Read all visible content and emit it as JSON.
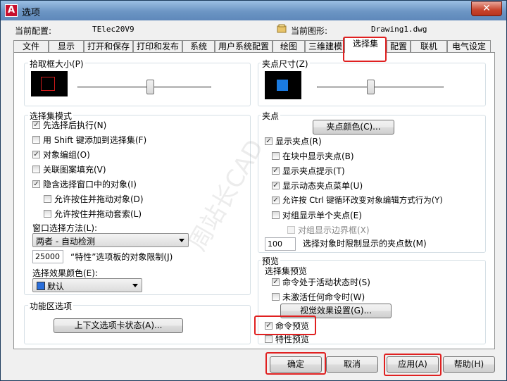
{
  "window": {
    "title": "选项",
    "close_glyph": "✕"
  },
  "header": {
    "profile_label": "当前配置:",
    "profile_value": "TElec20V9",
    "drawing_label": "当前图形:",
    "drawing_value": "Drawing1.dwg"
  },
  "tabs": [
    {
      "label": "文件"
    },
    {
      "label": "显示"
    },
    {
      "label": "打开和保存"
    },
    {
      "label": "打印和发布"
    },
    {
      "label": "系统"
    },
    {
      "label": "用户系统配置"
    },
    {
      "label": "绘图"
    },
    {
      "label": "三维建模"
    },
    {
      "label": "选择集"
    },
    {
      "label": "配置"
    },
    {
      "label": "联机"
    },
    {
      "label": "电气设定"
    }
  ],
  "pickbox": {
    "title": "拾取框大小(P)",
    "slider_level": 0.55,
    "preview_color": "#cc1a1a"
  },
  "grip_size": {
    "title": "夹点尺寸(Z)",
    "slider_level": 0.42,
    "preview_color": "#1a7ae0"
  },
  "selection_modes": {
    "title": "选择集模式",
    "items": [
      {
        "label": "先选择后执行(N)",
        "checked": true
      },
      {
        "label": "用 Shift 键添加到选择集(F)",
        "checked": false
      },
      {
        "label": "对象编组(O)",
        "checked": true
      },
      {
        "label": "关联图案填充(V)",
        "checked": false
      },
      {
        "label": "隐含选择窗口中的对象(I)",
        "checked": true
      },
      {
        "label": "允许按住并拖动对象(D)",
        "checked": false
      },
      {
        "label": "允许按住并拖动套索(L)",
        "checked": false
      }
    ],
    "window_method_label": "窗口选择方法(L):",
    "window_method_value": "两者 - 自动检测",
    "limit_value": "25000",
    "limit_label": "“特性”选项板的对象限制(J)",
    "effect_color_label": "选择效果颜色(E):",
    "effect_color_value": "默认",
    "effect_color_swatch": "#2a6fdb"
  },
  "ribbon": {
    "title": "功能区选项",
    "button": "上下文选项卡状态(A)..."
  },
  "grips": {
    "title": "夹点",
    "color_button": "夹点颜色(C)...",
    "items": [
      {
        "label": "显示夹点(R)",
        "checked": true
      },
      {
        "label": "在块中显示夹点(B)",
        "checked": false
      },
      {
        "label": "显示夹点提示(T)",
        "checked": true
      },
      {
        "label": "显示动态夹点菜单(U)",
        "checked": true
      },
      {
        "label": "允许按 Ctrl 键循环改变对象编辑方式行为(Y)",
        "checked": true
      },
      {
        "label": "对组显示单个夹点(E)",
        "checked": false
      },
      {
        "label": "对组显示边界框(X)",
        "checked": false,
        "disabled": true
      }
    ],
    "limit_value": "100",
    "limit_label": "选择对象时限制显示的夹点数(M)"
  },
  "preview": {
    "title": "预览",
    "sub_title": "选择集预览",
    "items": [
      {
        "label": "命令处于活动状态时(S)",
        "checked": true
      },
      {
        "label": "未激活任何命令时(W)",
        "checked": false
      }
    ],
    "effects_button": "视觉效果设置(G)...",
    "cmd_preview": {
      "label": "命令预览",
      "checked": true
    },
    "prop_preview": {
      "label": "特性预览",
      "checked": false
    }
  },
  "footer": {
    "ok": "确定",
    "cancel": "取消",
    "apply": "应用(A)",
    "help": "帮助(H)"
  },
  "watermark": "周站长CAD"
}
